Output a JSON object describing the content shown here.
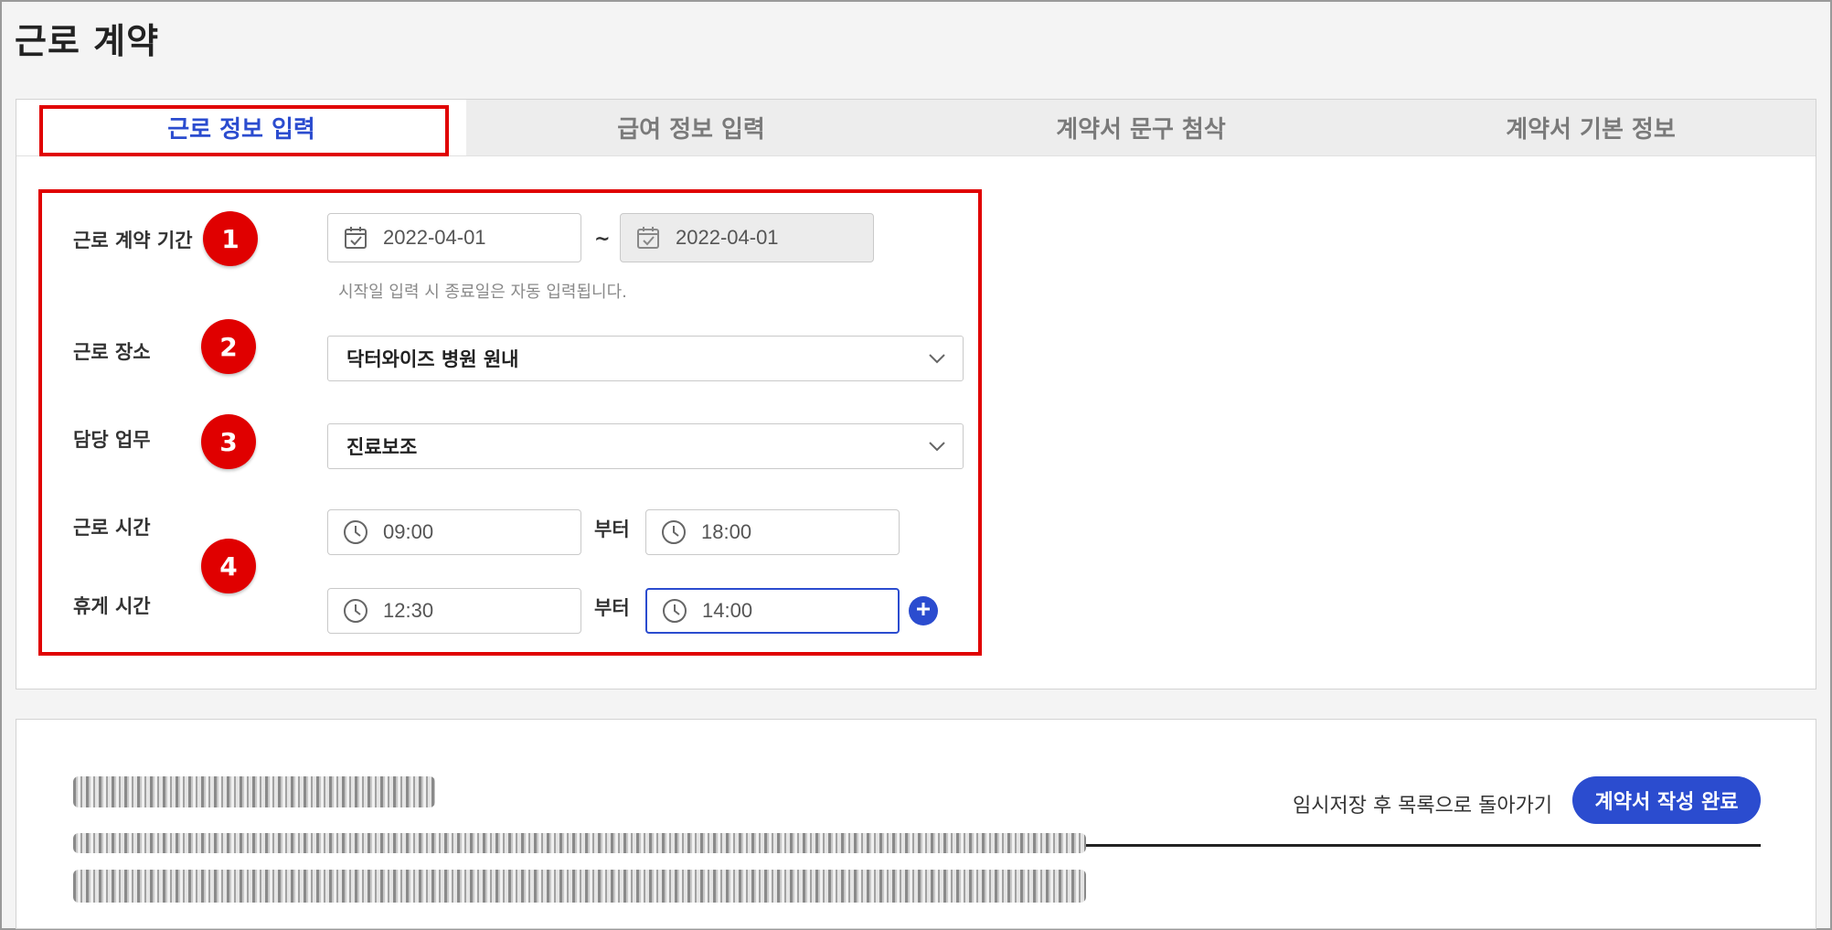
{
  "page": {
    "title": "근로 계약"
  },
  "tabs": [
    {
      "label": "근로 정보 입력",
      "active": true
    },
    {
      "label": "급여 정보 입력",
      "active": false
    },
    {
      "label": "계약서 문구 첨삭",
      "active": false
    },
    {
      "label": "계약서 기본 정보",
      "active": false
    }
  ],
  "form": {
    "period": {
      "label": "근로 계약 기간",
      "badge": "1",
      "start": "2022-04-01",
      "end": "2022-04-01",
      "separator": "~",
      "hint": "시작일 입력 시 종료일은 자동 입력됩니다."
    },
    "place": {
      "label": "근로 장소",
      "badge": "2",
      "value": "닥터와이즈 병원 원내"
    },
    "duty": {
      "label": "담당 업무",
      "badge": "3",
      "value": "진료보조"
    },
    "work_time": {
      "label": "근로 시간",
      "from": "09:00",
      "from_suffix": "부터",
      "to": "18:00"
    },
    "break_time": {
      "label": "휴게 시간",
      "from": "12:30",
      "from_suffix": "부터",
      "to": "14:00"
    },
    "time_badge": "4"
  },
  "footer": {
    "temp_save_label": "임시저장 후 목록으로 돌아가기",
    "complete_label": "계약서 작성 완료"
  },
  "colors": {
    "accent": "#2b4ccf",
    "highlight": "#e00000"
  },
  "icons": {
    "date": "calendar-icon",
    "time": "clock-icon",
    "dropdown": "chevron-down-icon",
    "add": "plus-icon"
  }
}
